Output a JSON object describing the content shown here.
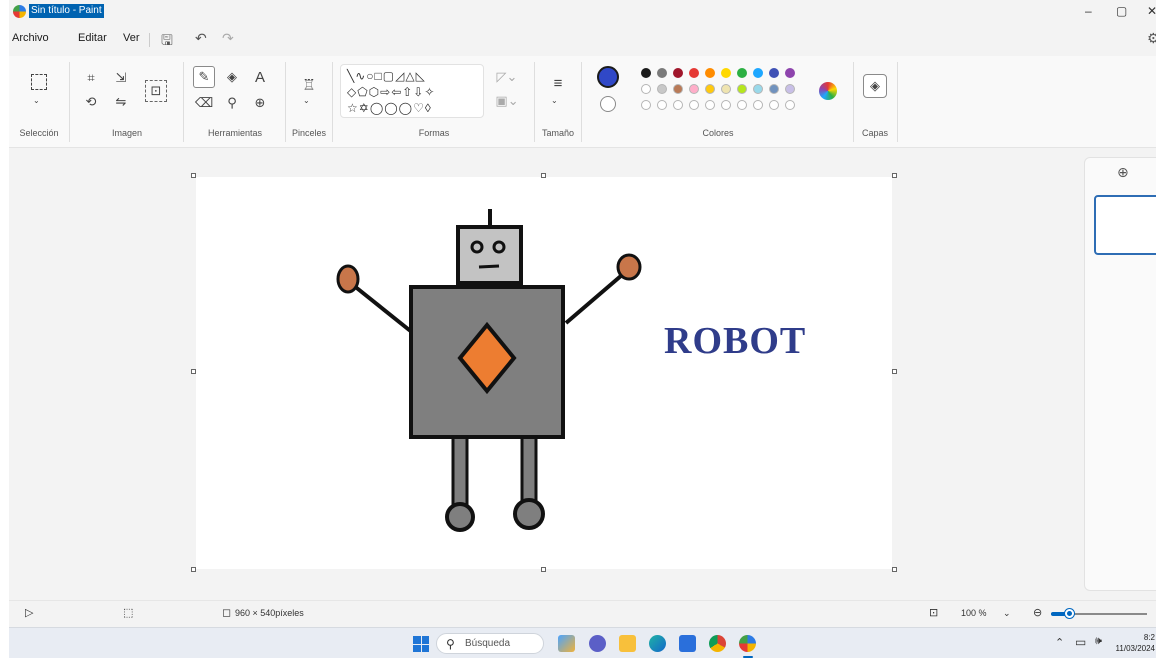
{
  "window": {
    "title": "Sin título - Paint"
  },
  "menu": {
    "file": "Archivo",
    "edit": "Editar",
    "view": "Ver"
  },
  "ribbon": {
    "groups": {
      "selection": "Selección",
      "image": "Imagen",
      "tools": "Herramientas",
      "brushes": "Pinceles",
      "shapes": "Formas",
      "size": "Tamaño",
      "colors": "Colores",
      "layers": "Capas"
    },
    "tools_text_glyph": "A",
    "palette_row1": [
      "#1b1b1b",
      "#7a7a7a",
      "#a0162b",
      "#e53935",
      "#ff8c00",
      "#ffd800",
      "#2cb043",
      "#1ea7ff",
      "#3f51b5",
      "#8e44ad"
    ],
    "palette_row2": [
      "#ffffff",
      "#c8c8c8",
      "#b97a57",
      "#ffaec9",
      "#ffc90e",
      "#efe4b0",
      "#b5e61d",
      "#99d9ea",
      "#7092be",
      "#c8bfe7"
    ],
    "primary_color": "#3048c7",
    "secondary_color": "#ffffff"
  },
  "canvas": {
    "title_text": "ROBOT",
    "colors": {
      "body": "#7f7f7f",
      "head": "#c3c3c3",
      "diamond": "#ed7d31",
      "hands": "#c8764a",
      "text": "#2f3c8a"
    }
  },
  "status": {
    "dimensions": "960 × 540píxeles",
    "zoom": "100 %"
  },
  "taskbar": {
    "search_placeholder": "Búsqueda",
    "time": "8:2",
    "date": "11/03/2024"
  }
}
